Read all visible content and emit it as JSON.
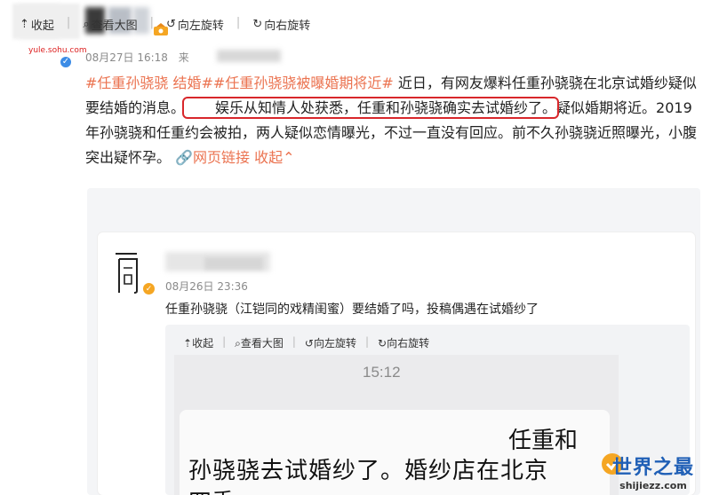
{
  "header": {
    "avatar_site_text": "yule.sohu.com",
    "post_date": "08月27日 16:18",
    "post_from": "来"
  },
  "post": {
    "tag1": "#任重孙骁骁 结婚#",
    "tag2": "#任重孙骁骁被曝婚期将近#",
    "text1": " 近日，有网友爆料任重孙骁骁在北京试婚纱疑似要结婚的消息。",
    "highlight": "娱乐从知情人处获悉，任重和孙骁骁确实去试婚纱了。",
    "text2": "疑似婚期将近。2019年孙骁骁和任重约会被拍，两人疑似恋情曝光，不过一直没有回应。前不久孙骁骁近照曝光，小腹突出疑怀孕。",
    "link_icon": "link-icon",
    "link_label": "网页链接",
    "collapse_label": "收起"
  },
  "toolbar": {
    "collapse": "收起",
    "view_large": "查看大图",
    "rotate_left": "向左旋转",
    "rotate_right": "向右旋转"
  },
  "card": {
    "logo_char": "同",
    "date": "08月26日 23:36",
    "text": "任重孙骁骁（江铠同的戏精闺蜜）要结婚了吗，投稿偶遇在试婚纱了"
  },
  "inner_toolbar": {
    "collapse": "收起",
    "view_large": "查看大图",
    "rotate_left": "向左旋转",
    "rotate_right": "向右旋转"
  },
  "phone": {
    "time": "15:12",
    "line1": "任重和",
    "line2": "孙骁骁去试婚纱了。婚纱店在北京",
    "line3": "四季"
  },
  "watermark": {
    "title": "世界之最",
    "url": "shijiezz.com"
  },
  "colors": {
    "tag": "#eb7350",
    "highlight_border": "#d8272b",
    "verify_blue": "#3c8ce6",
    "watermark_blue": "#1f5fb6"
  }
}
